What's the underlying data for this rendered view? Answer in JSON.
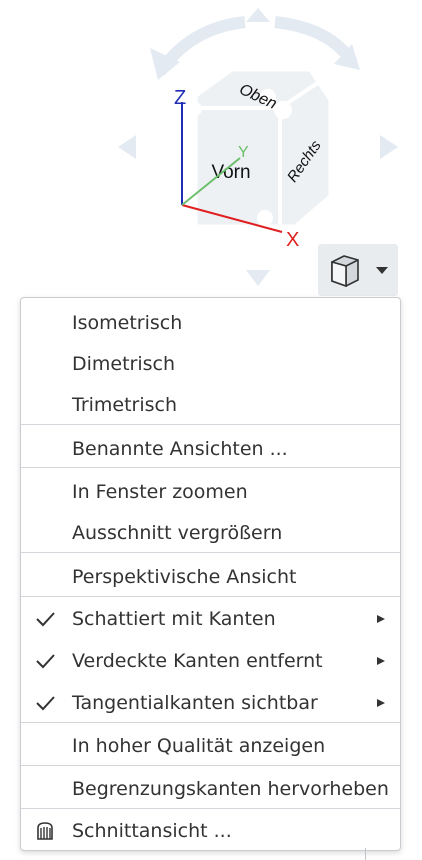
{
  "cube": {
    "faces": {
      "top": "Oben",
      "front": "Vorn",
      "right": "Rechts"
    },
    "axes": {
      "x": "X",
      "y": "Y",
      "z": "Z"
    },
    "colors": {
      "x": "#e02020",
      "y": "#6cbf6c",
      "z": "#1e2db4",
      "arrows": "#e3eaf1",
      "cube_fill": "#eef1f4"
    }
  },
  "view_button": {
    "icon": "cube-icon",
    "dropdown_icon": "chevron-down-icon"
  },
  "menu": {
    "items": [
      {
        "label": "Isometrisch",
        "checked": false,
        "submenu": false
      },
      {
        "label": "Dimetrisch",
        "checked": false,
        "submenu": false
      },
      {
        "label": "Trimetrisch",
        "checked": false,
        "submenu": false
      },
      {
        "label": "Benannte Ansichten ...",
        "checked": false,
        "submenu": false
      },
      {
        "label": "In Fenster zoomen",
        "checked": false,
        "submenu": false
      },
      {
        "label": "Ausschnitt vergrößern",
        "checked": false,
        "submenu": false
      },
      {
        "label": "Perspektivische Ansicht",
        "checked": false,
        "submenu": false
      },
      {
        "label": "Schattiert mit Kanten",
        "checked": true,
        "submenu": true
      },
      {
        "label": "Verdeckte Kanten entfernt",
        "checked": true,
        "submenu": true
      },
      {
        "label": "Tangentialkanten sichtbar",
        "checked": true,
        "submenu": true
      },
      {
        "label": "In hoher Qualität anzeigen",
        "checked": false,
        "submenu": false
      },
      {
        "label": "Begrenzungskanten hervorheben",
        "checked": false,
        "submenu": false
      },
      {
        "label": "Schnittansicht ...",
        "checked": false,
        "submenu": false,
        "icon": "section-view-icon"
      }
    ]
  }
}
